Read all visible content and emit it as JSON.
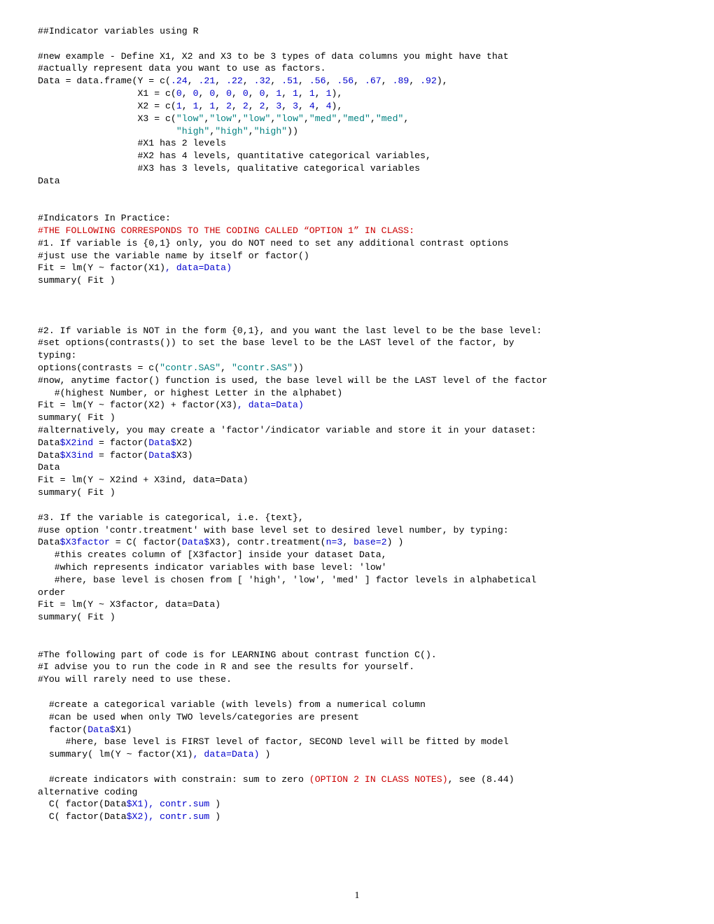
{
  "page_number": "1",
  "lines": [
    {
      "segs": [
        {
          "cls": "blk",
          "t": "##Indicator variables using R"
        }
      ]
    },
    {
      "segs": [
        {
          "cls": "blk",
          "t": " "
        }
      ]
    },
    {
      "segs": [
        {
          "cls": "blk",
          "t": "#new example - Define X1, X2 and X3 to be 3 types of data columns you might have that"
        }
      ]
    },
    {
      "segs": [
        {
          "cls": "blk",
          "t": "#actually represent data you want to use as factors."
        }
      ]
    },
    {
      "segs": [
        {
          "cls": "blk",
          "t": "Data = data.frame(Y = c("
        },
        {
          "cls": "blue",
          "t": ".24"
        },
        {
          "cls": "blk",
          "t": ", "
        },
        {
          "cls": "blue",
          "t": ".21"
        },
        {
          "cls": "blk",
          "t": ", "
        },
        {
          "cls": "blue",
          "t": ".22"
        },
        {
          "cls": "blk",
          "t": ", "
        },
        {
          "cls": "blue",
          "t": ".32"
        },
        {
          "cls": "blk",
          "t": ", "
        },
        {
          "cls": "blue",
          "t": ".51"
        },
        {
          "cls": "blk",
          "t": ", "
        },
        {
          "cls": "blue",
          "t": ".56"
        },
        {
          "cls": "blk",
          "t": ", "
        },
        {
          "cls": "blue",
          "t": ".56"
        },
        {
          "cls": "blk",
          "t": ", "
        },
        {
          "cls": "blue",
          "t": ".67"
        },
        {
          "cls": "blk",
          "t": ", "
        },
        {
          "cls": "blue",
          "t": ".89"
        },
        {
          "cls": "blk",
          "t": ", "
        },
        {
          "cls": "blue",
          "t": ".92"
        },
        {
          "cls": "blk",
          "t": "),"
        }
      ]
    },
    {
      "segs": [
        {
          "cls": "blk",
          "t": "                  X1 = c("
        },
        {
          "cls": "blue",
          "t": "0"
        },
        {
          "cls": "blk",
          "t": ", "
        },
        {
          "cls": "blue",
          "t": "0"
        },
        {
          "cls": "blk",
          "t": ", "
        },
        {
          "cls": "blue",
          "t": "0"
        },
        {
          "cls": "blk",
          "t": ", "
        },
        {
          "cls": "blue",
          "t": "0"
        },
        {
          "cls": "blk",
          "t": ", "
        },
        {
          "cls": "blue",
          "t": "0"
        },
        {
          "cls": "blk",
          "t": ", "
        },
        {
          "cls": "blue",
          "t": "0"
        },
        {
          "cls": "blk",
          "t": ", "
        },
        {
          "cls": "blue",
          "t": "1"
        },
        {
          "cls": "blk",
          "t": ", "
        },
        {
          "cls": "blue",
          "t": "1"
        },
        {
          "cls": "blk",
          "t": ", "
        },
        {
          "cls": "blue",
          "t": "1"
        },
        {
          "cls": "blk",
          "t": ", "
        },
        {
          "cls": "blue",
          "t": "1"
        },
        {
          "cls": "blk",
          "t": "),"
        }
      ]
    },
    {
      "segs": [
        {
          "cls": "blk",
          "t": "                  X2 = c("
        },
        {
          "cls": "blue",
          "t": "1"
        },
        {
          "cls": "blk",
          "t": ", "
        },
        {
          "cls": "blue",
          "t": "1"
        },
        {
          "cls": "blk",
          "t": ", "
        },
        {
          "cls": "blue",
          "t": "1"
        },
        {
          "cls": "blk",
          "t": ", "
        },
        {
          "cls": "blue",
          "t": "2"
        },
        {
          "cls": "blk",
          "t": ", "
        },
        {
          "cls": "blue",
          "t": "2"
        },
        {
          "cls": "blk",
          "t": ", "
        },
        {
          "cls": "blue",
          "t": "2"
        },
        {
          "cls": "blk",
          "t": ", "
        },
        {
          "cls": "blue",
          "t": "3"
        },
        {
          "cls": "blk",
          "t": ", "
        },
        {
          "cls": "blue",
          "t": "3"
        },
        {
          "cls": "blk",
          "t": ", "
        },
        {
          "cls": "blue",
          "t": "4"
        },
        {
          "cls": "blk",
          "t": ", "
        },
        {
          "cls": "blue",
          "t": "4"
        },
        {
          "cls": "blk",
          "t": "),"
        }
      ]
    },
    {
      "segs": [
        {
          "cls": "blk",
          "t": "                  X3 = c("
        },
        {
          "cls": "teal",
          "t": "\"low\""
        },
        {
          "cls": "blk",
          "t": ","
        },
        {
          "cls": "teal",
          "t": "\"low\""
        },
        {
          "cls": "blk",
          "t": ","
        },
        {
          "cls": "teal",
          "t": "\"low\""
        },
        {
          "cls": "blk",
          "t": ","
        },
        {
          "cls": "teal",
          "t": "\"low\""
        },
        {
          "cls": "blk",
          "t": ","
        },
        {
          "cls": "teal",
          "t": "\"med\""
        },
        {
          "cls": "blk",
          "t": ","
        },
        {
          "cls": "teal",
          "t": "\"med\""
        },
        {
          "cls": "blk",
          "t": ","
        },
        {
          "cls": "teal",
          "t": "\"med\""
        },
        {
          "cls": "blk",
          "t": ","
        }
      ]
    },
    {
      "segs": [
        {
          "cls": "blk",
          "t": "                         "
        },
        {
          "cls": "teal",
          "t": "\"high\""
        },
        {
          "cls": "blk",
          "t": ","
        },
        {
          "cls": "teal",
          "t": "\"high\""
        },
        {
          "cls": "blk",
          "t": ","
        },
        {
          "cls": "teal",
          "t": "\"high\""
        },
        {
          "cls": "blk",
          "t": "))"
        }
      ]
    },
    {
      "segs": [
        {
          "cls": "blk",
          "t": "                  #X1 has 2 levels"
        }
      ]
    },
    {
      "segs": [
        {
          "cls": "blk",
          "t": "                  #X2 has 4 levels, quantitative categorical variables,"
        }
      ]
    },
    {
      "segs": [
        {
          "cls": "blk",
          "t": "                  #X3 has 3 levels, qualitative categorical variables"
        }
      ]
    },
    {
      "segs": [
        {
          "cls": "blk",
          "t": "Data"
        }
      ]
    },
    {
      "segs": [
        {
          "cls": "blk",
          "t": " "
        }
      ]
    },
    {
      "segs": [
        {
          "cls": "blk",
          "t": " "
        }
      ]
    },
    {
      "segs": [
        {
          "cls": "blk",
          "t": "#Indicators In Practice:"
        }
      ]
    },
    {
      "segs": [
        {
          "cls": "red",
          "t": "#THE FOLLOWING CORRESPONDS TO THE CODING CALLED “OPTION 1” IN CLASS:"
        }
      ]
    },
    {
      "segs": [
        {
          "cls": "blk",
          "t": "#1. If variable is {0,1} only, you do NOT need to set any additional contrast options"
        }
      ]
    },
    {
      "segs": [
        {
          "cls": "blk",
          "t": "#just use the variable name by itself or factor()"
        }
      ]
    },
    {
      "segs": [
        {
          "cls": "blk",
          "t": "Fit = lm(Y ~ factor(X1)"
        },
        {
          "cls": "blue",
          "t": ", data=Data)"
        }
      ]
    },
    {
      "segs": [
        {
          "cls": "blk",
          "t": "summary( Fit )"
        }
      ]
    },
    {
      "segs": [
        {
          "cls": "blk",
          "t": " "
        }
      ]
    },
    {
      "segs": [
        {
          "cls": "blk",
          "t": " "
        }
      ]
    },
    {
      "segs": [
        {
          "cls": "blk",
          "t": " "
        }
      ]
    },
    {
      "segs": [
        {
          "cls": "blk",
          "t": "#2. If variable is NOT in the form {0,1}, and you want the last level to be the base level:"
        }
      ]
    },
    {
      "segs": [
        {
          "cls": "blk",
          "t": "#set options(contrasts()) to set the base level to be the LAST level of the factor, by"
        }
      ]
    },
    {
      "segs": [
        {
          "cls": "blk",
          "t": "typing:"
        }
      ]
    },
    {
      "segs": [
        {
          "cls": "blk",
          "t": "options(contrasts = c("
        },
        {
          "cls": "teal",
          "t": "\"contr.SAS\""
        },
        {
          "cls": "blk",
          "t": ", "
        },
        {
          "cls": "teal",
          "t": "\"contr.SAS\""
        },
        {
          "cls": "blk",
          "t": "))"
        }
      ]
    },
    {
      "segs": [
        {
          "cls": "blk",
          "t": "#now, anytime factor() function is used, the base level will be the LAST level of the factor"
        }
      ]
    },
    {
      "segs": [
        {
          "cls": "blk",
          "t": "   #(highest Number, or highest Letter in the alphabet)"
        }
      ]
    },
    {
      "segs": [
        {
          "cls": "blk",
          "t": "Fit = lm(Y ~ factor(X2) + factor(X3)"
        },
        {
          "cls": "blue",
          "t": ", data=Data)"
        }
      ]
    },
    {
      "segs": [
        {
          "cls": "blk",
          "t": "summary( Fit )"
        }
      ]
    },
    {
      "segs": [
        {
          "cls": "blk",
          "t": "#alternatively, you may create a 'factor'/indicator variable and store it in your dataset:"
        }
      ]
    },
    {
      "segs": [
        {
          "cls": "blk",
          "t": "Data"
        },
        {
          "cls": "blue",
          "t": "$X2ind"
        },
        {
          "cls": "blk",
          "t": " = factor("
        },
        {
          "cls": "blue",
          "t": "Data$"
        },
        {
          "cls": "blk",
          "t": "X2)"
        }
      ]
    },
    {
      "segs": [
        {
          "cls": "blk",
          "t": "Data"
        },
        {
          "cls": "blue",
          "t": "$X3ind"
        },
        {
          "cls": "blk",
          "t": " = factor("
        },
        {
          "cls": "blue",
          "t": "Data$"
        },
        {
          "cls": "blk",
          "t": "X3)"
        }
      ]
    },
    {
      "segs": [
        {
          "cls": "blk",
          "t": "Data"
        }
      ]
    },
    {
      "segs": [
        {
          "cls": "blk",
          "t": "Fit = lm(Y ~ X2ind + X3ind, data=Data)"
        }
      ]
    },
    {
      "segs": [
        {
          "cls": "blk",
          "t": "summary( Fit )"
        }
      ]
    },
    {
      "segs": [
        {
          "cls": "blk",
          "t": " "
        }
      ]
    },
    {
      "segs": [
        {
          "cls": "blk",
          "t": "#3. If the variable is categorical, i.e. {text},"
        }
      ]
    },
    {
      "segs": [
        {
          "cls": "blk",
          "t": "#use option 'contr.treatment' with base level set to desired level number, by typing:"
        }
      ]
    },
    {
      "segs": [
        {
          "cls": "blk",
          "t": "Data"
        },
        {
          "cls": "blue",
          "t": "$X3factor"
        },
        {
          "cls": "blk",
          "t": " = C( factor("
        },
        {
          "cls": "blue",
          "t": "Data$"
        },
        {
          "cls": "blk",
          "t": "X3), contr.treatment("
        },
        {
          "cls": "blue",
          "t": "n=3"
        },
        {
          "cls": "blk",
          "t": ", "
        },
        {
          "cls": "blue",
          "t": "base=2"
        },
        {
          "cls": "blk",
          "t": ") )"
        }
      ]
    },
    {
      "segs": [
        {
          "cls": "blk",
          "t": "   #this creates column of [X3factor] inside your dataset Data,"
        }
      ]
    },
    {
      "segs": [
        {
          "cls": "blk",
          "t": "   #which represents indicator variables with base level: 'low'"
        }
      ]
    },
    {
      "segs": [
        {
          "cls": "blk",
          "t": "   #here, base level is chosen from [ 'high', 'low', 'med' ] factor levels in alphabetical"
        }
      ]
    },
    {
      "segs": [
        {
          "cls": "blk",
          "t": "order"
        }
      ]
    },
    {
      "segs": [
        {
          "cls": "blk",
          "t": "Fit = lm(Y ~ X3factor, data=Data)"
        }
      ]
    },
    {
      "segs": [
        {
          "cls": "blk",
          "t": "summary( Fit )"
        }
      ]
    },
    {
      "segs": [
        {
          "cls": "blk",
          "t": " "
        }
      ]
    },
    {
      "segs": [
        {
          "cls": "blk",
          "t": " "
        }
      ]
    },
    {
      "segs": [
        {
          "cls": "blk",
          "t": "#The following part of code is for LEARNING about contrast function C()."
        }
      ]
    },
    {
      "segs": [
        {
          "cls": "blk",
          "t": "#I advise you to run the code in R and see the results for yourself."
        }
      ]
    },
    {
      "segs": [
        {
          "cls": "blk",
          "t": "#You will rarely need to use these."
        }
      ]
    },
    {
      "segs": [
        {
          "cls": "blk",
          "t": " "
        }
      ]
    },
    {
      "segs": [
        {
          "cls": "blk",
          "t": "  #create a categorical variable (with levels) from a numerical column"
        }
      ]
    },
    {
      "segs": [
        {
          "cls": "blk",
          "t": "  #can be used when only TWO levels/categories are present"
        }
      ]
    },
    {
      "segs": [
        {
          "cls": "blk",
          "t": "  factor("
        },
        {
          "cls": "blue",
          "t": "Data$"
        },
        {
          "cls": "blk",
          "t": "X1)"
        }
      ]
    },
    {
      "segs": [
        {
          "cls": "blk",
          "t": "     #here, base level is FIRST level of factor, SECOND level will be fitted by model"
        }
      ]
    },
    {
      "segs": [
        {
          "cls": "blk",
          "t": "  summary( lm(Y ~ factor(X1)"
        },
        {
          "cls": "blue",
          "t": ", data=Data)"
        },
        {
          "cls": "blk",
          "t": " )"
        }
      ]
    },
    {
      "segs": [
        {
          "cls": "blk",
          "t": " "
        }
      ]
    },
    {
      "segs": [
        {
          "cls": "blk",
          "t": "  #create indicators with constrain: sum to zero "
        },
        {
          "cls": "red",
          "t": "(OPTION 2 IN CLASS NOTES)"
        },
        {
          "cls": "blk",
          "t": ", see (8.44)"
        }
      ]
    },
    {
      "segs": [
        {
          "cls": "blk",
          "t": "alternative coding"
        }
      ]
    },
    {
      "segs": [
        {
          "cls": "blk",
          "t": "  C( factor(Data"
        },
        {
          "cls": "blue",
          "t": "$X1), contr.sum "
        },
        {
          "cls": "blk",
          "t": ")"
        }
      ]
    },
    {
      "segs": [
        {
          "cls": "blk",
          "t": "  C( factor(Data"
        },
        {
          "cls": "blue",
          "t": "$X2), contr.sum "
        },
        {
          "cls": "blk",
          "t": ")"
        }
      ]
    }
  ]
}
